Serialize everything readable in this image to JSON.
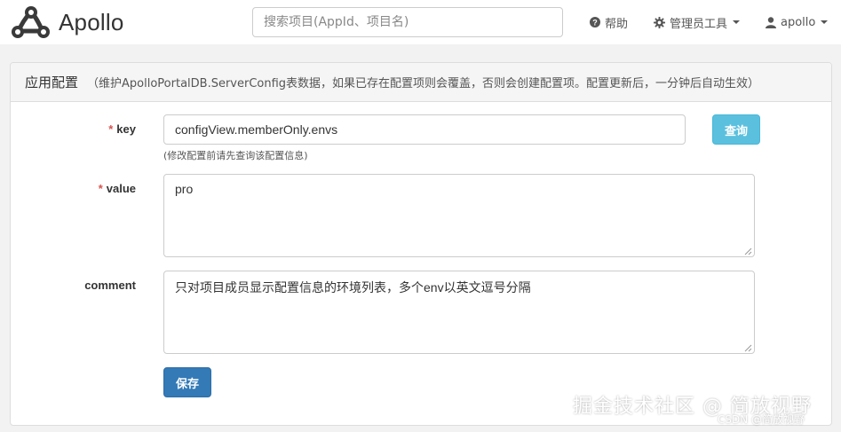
{
  "navbar": {
    "brand": "Apollo",
    "search_placeholder": "搜索项目(AppId、项目名)",
    "help_label": "帮助",
    "admin_tools_label": "管理员工具",
    "user_label": "apollo"
  },
  "panel": {
    "title": "应用配置",
    "description": "（维护ApolloPortalDB.ServerConfig表数据，如果已存在配置项则会覆盖，否则会创建配置项。配置更新后，一分钟后自动生效）"
  },
  "form": {
    "required_mark": "*",
    "key_label": "key",
    "key_value": "configView.memberOnly.envs",
    "key_help": "(修改配置前请先查询该配置信息)",
    "query_button": "查询",
    "value_label": "value",
    "value_value": "pro",
    "comment_label": "comment",
    "comment_value": "只对项目成员显示配置信息的环境列表，多个env以英文逗号分隔",
    "save_button": "保存"
  },
  "watermark": {
    "main": "掘金技术社区 @ 简放视野",
    "sub": "CSDN @简放视野"
  },
  "colors": {
    "required": "#d9534f",
    "query_button": "#5bc0de",
    "save_button": "#337ab7"
  },
  "icons": {
    "brand": "apollo-logo-icon",
    "help": "question-circle-icon",
    "admin_tools": "gear-icon",
    "user": "user-icon"
  }
}
